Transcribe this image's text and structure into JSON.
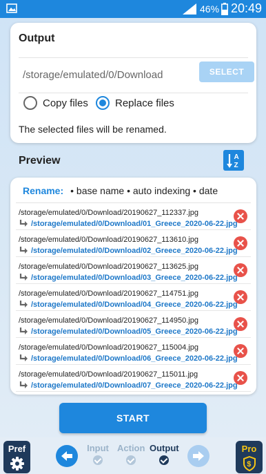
{
  "status_bar": {
    "battery_percent": "46%",
    "time": "20:49",
    "icons": [
      "gallery-icon",
      "signal-icon",
      "battery-icon"
    ]
  },
  "output": {
    "title": "Output",
    "path": "/storage/emulated/0/Download",
    "select_label": "SELECT",
    "options": [
      {
        "label": "Copy files",
        "selected": false
      },
      {
        "label": "Replace files",
        "selected": true
      }
    ],
    "note": "The selected files will be renamed."
  },
  "preview": {
    "title": "Preview",
    "sort_icon": "sort-a-z-icon",
    "rename_label": "Rename:",
    "rename_pattern": "• base name • auto indexing • date",
    "items": [
      {
        "original": "/storage/emulated/0/Download/20190627_112337.jpg",
        "renamed": "/storage/emulated/0/Download/01_Greece_2020-06-22.jpg"
      },
      {
        "original": "/storage/emulated/0/Download/20190627_113610.jpg",
        "renamed": "/storage/emulated/0/Download/02_Greece_2020-06-22.jpg"
      },
      {
        "original": "/storage/emulated/0/Download/20190627_113625.jpg",
        "renamed": "/storage/emulated/0/Download/03_Greece_2020-06-22.jpg"
      },
      {
        "original": "/storage/emulated/0/Download/20190627_114751.jpg",
        "renamed": "/storage/emulated/0/Download/04_Greece_2020-06-22.jpg"
      },
      {
        "original": "/storage/emulated/0/Download/20190627_114950.jpg",
        "renamed": "/storage/emulated/0/Download/05_Greece_2020-06-22.jpg"
      },
      {
        "original": "/storage/emulated/0/Download/20190627_115004.jpg",
        "renamed": "/storage/emulated/0/Download/06_Greece_2020-06-22.jpg"
      },
      {
        "original": "/storage/emulated/0/Download/20190627_115011.jpg",
        "renamed": "/storage/emulated/0/Download/07_Greece_2020-06-22.jpg"
      }
    ]
  },
  "start_label": "START",
  "bottom_nav": {
    "pref_label": "Pref",
    "pro_label": "Pro",
    "steps": [
      {
        "label": "Input",
        "current": false
      },
      {
        "label": "Action",
        "current": false
      },
      {
        "label": "Output",
        "current": true
      }
    ]
  },
  "colors": {
    "accent": "#1e87dd",
    "dark": "#1f3a5b",
    "remove": "#e8524a",
    "pro": "#f6c514"
  }
}
